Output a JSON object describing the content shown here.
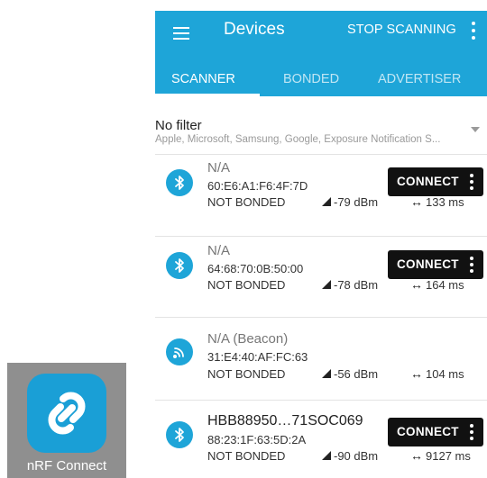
{
  "app_icon": {
    "label": "nRF Connect",
    "color": "#1a9fd6"
  },
  "appbar": {
    "title": "Devices",
    "stop_label": "STOP SCANNING",
    "color": "#1ea5d8"
  },
  "tabs": [
    {
      "label": "SCANNER",
      "active": true
    },
    {
      "label": "BONDED",
      "active": false
    },
    {
      "label": "ADVERTISER",
      "active": false
    }
  ],
  "filter": {
    "title": "No filter",
    "subtitle": "Apple, Microsoft, Samsung, Google, Exposure Notification S..."
  },
  "devices": [
    {
      "name": "N/A",
      "mac": "60:E6:A1:F6:4F:7D",
      "bond": "NOT BONDED",
      "rssi": "-79 dBm",
      "interval": "133 ms",
      "icon": "bluetooth-icon",
      "connect_label": "CONNECT"
    },
    {
      "name": "N/A",
      "mac": "64:68:70:0B:50:00",
      "bond": "NOT BONDED",
      "rssi": "-78 dBm",
      "interval": "164 ms",
      "icon": "bluetooth-icon",
      "connect_label": "CONNECT"
    },
    {
      "name": "N/A  (Beacon)",
      "mac": "31:E4:40:AF:FC:63",
      "bond": "NOT BONDED",
      "rssi": "-56 dBm",
      "interval": "104 ms",
      "icon": "beacon-icon"
    },
    {
      "name": "HBB88950…71SOC069",
      "mac": "88:23:1F:63:5D:2A",
      "bond": "NOT BONDED",
      "rssi": "-90 dBm",
      "interval": "9127 ms",
      "icon": "bluetooth-icon",
      "connect_label": "CONNECT"
    }
  ]
}
